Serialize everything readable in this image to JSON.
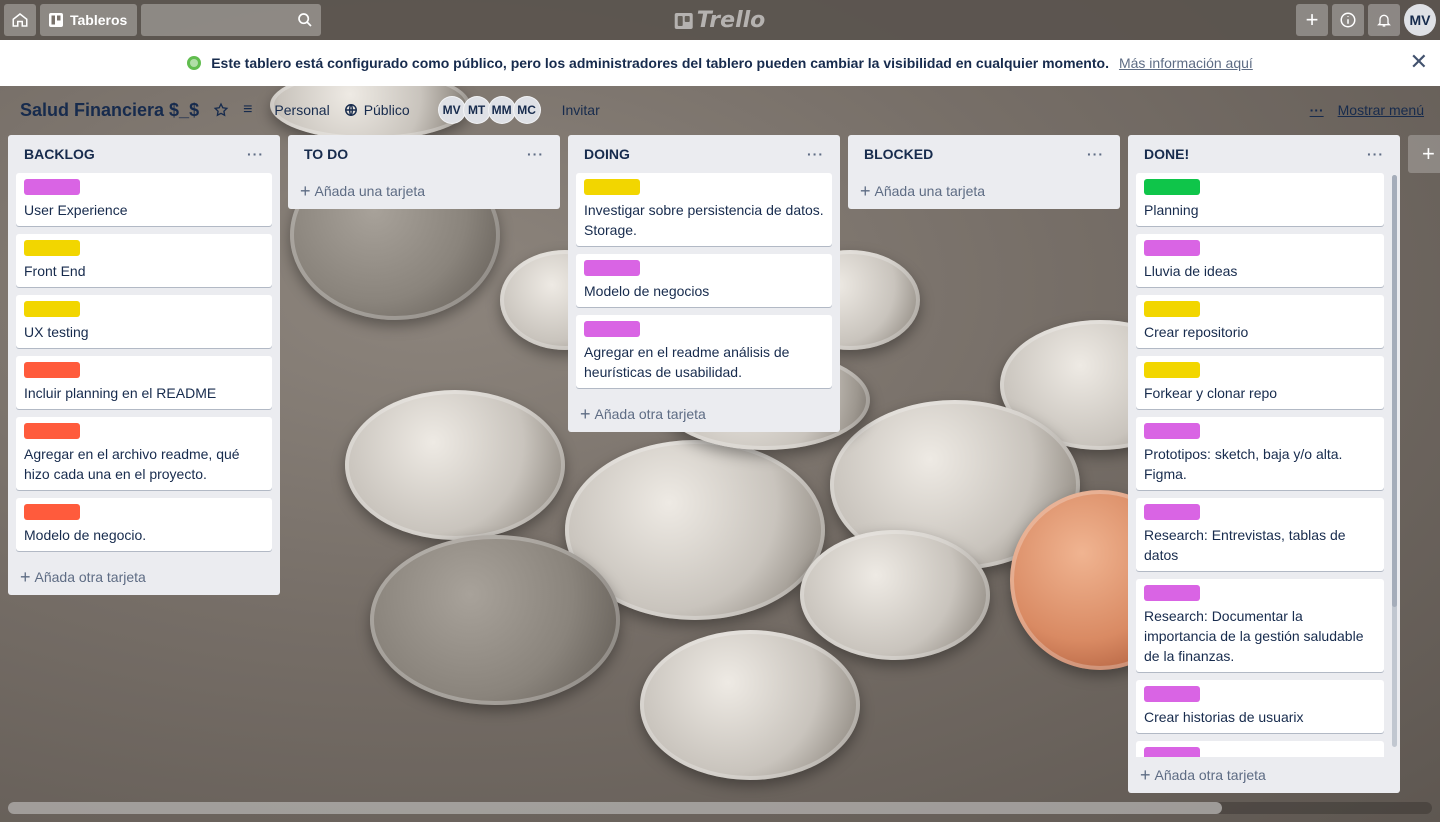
{
  "header": {
    "boards_label": "Tableros",
    "logo": "Trello",
    "user_initials": "MV"
  },
  "banner": {
    "message": "Este tablero está configurado como público, pero los administradores del tablero pueden cambiar la visibilidad en cualquier momento.",
    "link": "Más información aquí"
  },
  "board": {
    "title": "Salud Financiera $_$",
    "team": "Personal",
    "visibility": "Público",
    "members": [
      "MV",
      "MT",
      "MM",
      "MC"
    ],
    "invite": "Invitar",
    "show_menu": "Mostrar menú",
    "menu_dots": "···"
  },
  "labels": {
    "purple": "#d964e4",
    "yellow": "#f2d600",
    "red": "#ff5b3c",
    "green": "#0fc54a"
  },
  "lists": [
    {
      "title": "BACKLOG",
      "add": "Añada otra tarjeta",
      "cards": [
        {
          "label": "purple",
          "text": "User Experience"
        },
        {
          "label": "yellow",
          "text": "Front End"
        },
        {
          "label": "yellow",
          "text": "UX testing"
        },
        {
          "label": "red",
          "text": "Incluir planning en el README"
        },
        {
          "label": "red",
          "text": "Agregar en el archivo readme, qué hizo cada una en el proyecto."
        },
        {
          "label": "red",
          "text": "Modelo de negocio."
        }
      ]
    },
    {
      "title": "TO DO",
      "add": "Añada una tarjeta",
      "cards": []
    },
    {
      "title": "DOING",
      "add": "Añada otra tarjeta",
      "cards": [
        {
          "label": "yellow",
          "text": "Investigar sobre persistencia de datos. Storage."
        },
        {
          "label": "purple",
          "text": "Modelo de negocios"
        },
        {
          "label": "purple",
          "text": "Agregar en el readme análisis de heurísticas de usabilidad."
        }
      ]
    },
    {
      "title": "BLOCKED",
      "add": "Añada una tarjeta",
      "cards": []
    },
    {
      "title": "DONE!",
      "add": "Añada otra tarjeta",
      "cards": [
        {
          "label": "green",
          "text": "Planning"
        },
        {
          "label": "purple",
          "text": "Lluvia de ideas"
        },
        {
          "label": "yellow",
          "text": "Crear repositorio"
        },
        {
          "label": "yellow",
          "text": "Forkear y clonar repo"
        },
        {
          "label": "purple",
          "text": "Prototipos: sketch, baja y/o alta. Figma."
        },
        {
          "label": "purple",
          "text": "Research: Entrevistas, tablas de datos"
        },
        {
          "label": "purple",
          "text": "Research: Documentar la importancia de la gestión saludable de la finanzas."
        },
        {
          "label": "purple",
          "text": "Crear historias de usuarix"
        },
        {
          "label": "purple",
          "text": ""
        }
      ]
    }
  ]
}
